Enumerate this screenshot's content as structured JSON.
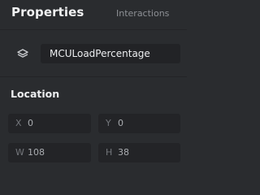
{
  "tabs": {
    "properties": "Properties",
    "interactions": "Interactions"
  },
  "component": {
    "icon": "layers-icon",
    "name": "MCULoadPercentage"
  },
  "location": {
    "title": "Location",
    "x": {
      "label": "X",
      "value": "0"
    },
    "y": {
      "label": "Y",
      "value": "0"
    },
    "w": {
      "label": "W",
      "value": "108"
    },
    "h": {
      "label": "H",
      "value": "38"
    }
  }
}
